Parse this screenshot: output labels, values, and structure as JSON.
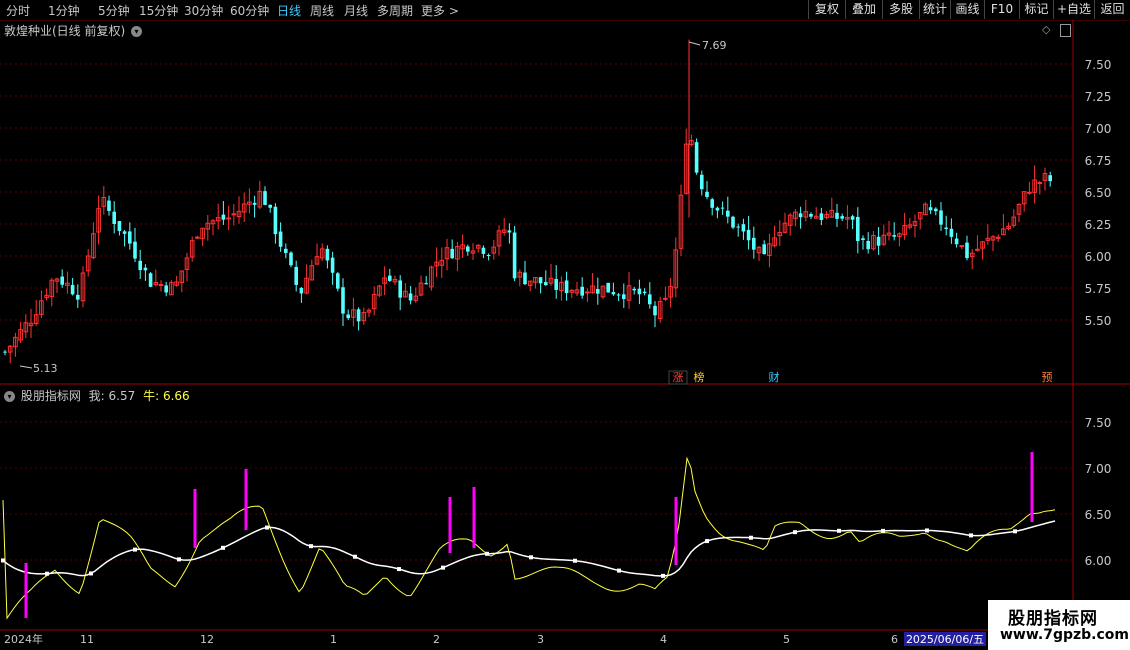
{
  "toolbar": {
    "periods": [
      "分时",
      "1分钟",
      "5分钟",
      "15分钟",
      "30分钟",
      "60分钟",
      "日线",
      "周线",
      "月线",
      "多周期",
      "更多 >"
    ],
    "active_period": "日线",
    "right_buttons": [
      "复权",
      "叠加",
      "多股",
      "统计",
      "画线",
      "F10",
      "标记",
      "+自选",
      "返回"
    ]
  },
  "main_panel": {
    "title": "敦煌种业(日线 前复权)",
    "y_ticks": [
      "7.50",
      "7.25",
      "7.00",
      "6.75",
      "6.50",
      "6.25",
      "6.00",
      "5.75",
      "5.50"
    ],
    "high_label": "7.69",
    "low_label": "5.13",
    "markers": [
      {
        "text": "涨",
        "color": "#ff4040"
      },
      {
        "text": "榜",
        "color": "#ffcc33"
      },
      {
        "text": "财",
        "color": "#40c8ff"
      },
      {
        "text": "预",
        "color": "#ff8040"
      }
    ]
  },
  "indicator_panel": {
    "title": "股朋指标网",
    "me_label": "我:",
    "me_value": "6.57",
    "niu_label": "牛:",
    "niu_value": "6.66",
    "y_ticks": [
      "7.50",
      "7.00",
      "6.50",
      "6.00"
    ]
  },
  "x_axis": {
    "labels": [
      "2024年",
      "11",
      "12",
      "1",
      "2",
      "3",
      "4",
      "5",
      "6"
    ],
    "current_date": "2025/06/06/五"
  },
  "watermark": {
    "line1": "股朋指标网",
    "line2": "www.7gpzb.com"
  },
  "chart_data": {
    "type": "candlestick",
    "title": "敦煌种业(日线 前复权)",
    "y_range": [
      5.13,
      7.69
    ],
    "y_ticks": [
      5.5,
      5.75,
      6.0,
      6.25,
      6.5,
      6.75,
      7.0,
      7.25,
      7.5
    ],
    "annotated_high": 7.69,
    "annotated_low": 5.13,
    "indicator": {
      "name": "股朋指标网",
      "series": [
        {
          "name": "我",
          "last_value": 6.57
        },
        {
          "name": "牛",
          "last_value": 6.66
        }
      ],
      "y_ticks": [
        6.0,
        6.5,
        7.0,
        7.5
      ]
    },
    "x_labels": [
      "2024年",
      "11",
      "12",
      "1",
      "2",
      "3",
      "4",
      "5",
      "6"
    ]
  },
  "colors": {
    "up": "#ff3232",
    "down": "#54ffff",
    "grid": "#5a0000",
    "fast_line": "#ffff40",
    "slow_line": "#ffffff",
    "signal": "#ff00ff",
    "axis_text": "#c8c8c8",
    "active_tab": "#40c8ff"
  }
}
